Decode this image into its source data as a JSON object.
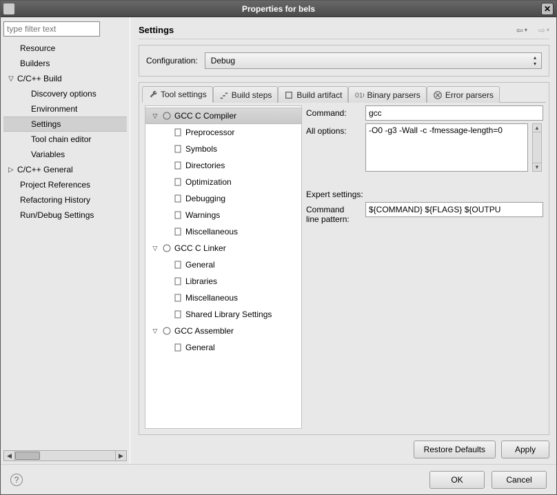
{
  "window": {
    "title": "Properties for bels"
  },
  "left": {
    "filter_placeholder": "type filter text",
    "items": {
      "resource": "Resource",
      "builders": "Builders",
      "ccbuild": "C/C++ Build",
      "discovery": "Discovery options",
      "environment": "Environment",
      "settings": "Settings",
      "toolchain": "Tool chain editor",
      "variables": "Variables",
      "ccgeneral": "C/C++ General",
      "projrefs": "Project References",
      "refhist": "Refactoring History",
      "rundebug": "Run/Debug Settings"
    }
  },
  "right": {
    "heading": "Settings",
    "config_label": "Configuration:",
    "config_value": "Debug",
    "tabs": {
      "tool": "Tool settings",
      "steps": "Build steps",
      "artifact": "Build artifact",
      "binary": "Binary parsers",
      "error": "Error parsers"
    },
    "tooltree": {
      "compiler": "GCC C Compiler",
      "preprocessor": "Preprocessor",
      "symbols": "Symbols",
      "directories": "Directories",
      "optimization": "Optimization",
      "debugging": "Debugging",
      "warnings": "Warnings",
      "misc1": "Miscellaneous",
      "linker": "GCC C Linker",
      "general1": "General",
      "libraries": "Libraries",
      "misc2": "Miscellaneous",
      "shared": "Shared Library Settings",
      "assembler": "GCC Assembler",
      "general2": "General"
    },
    "form": {
      "command_label": "Command:",
      "command_value": "gcc",
      "alloptions_label": "All options:",
      "alloptions_value": "-O0 -g3 -Wall -c -fmessage-length=0",
      "expert_heading": "Expert settings:",
      "clp_label1": "Command",
      "clp_label2": "line pattern:",
      "clp_value": "${COMMAND} ${FLAGS} ${OUTPU"
    },
    "restore": "Restore Defaults",
    "apply": "Apply"
  },
  "footer": {
    "ok": "OK",
    "cancel": "Cancel"
  }
}
